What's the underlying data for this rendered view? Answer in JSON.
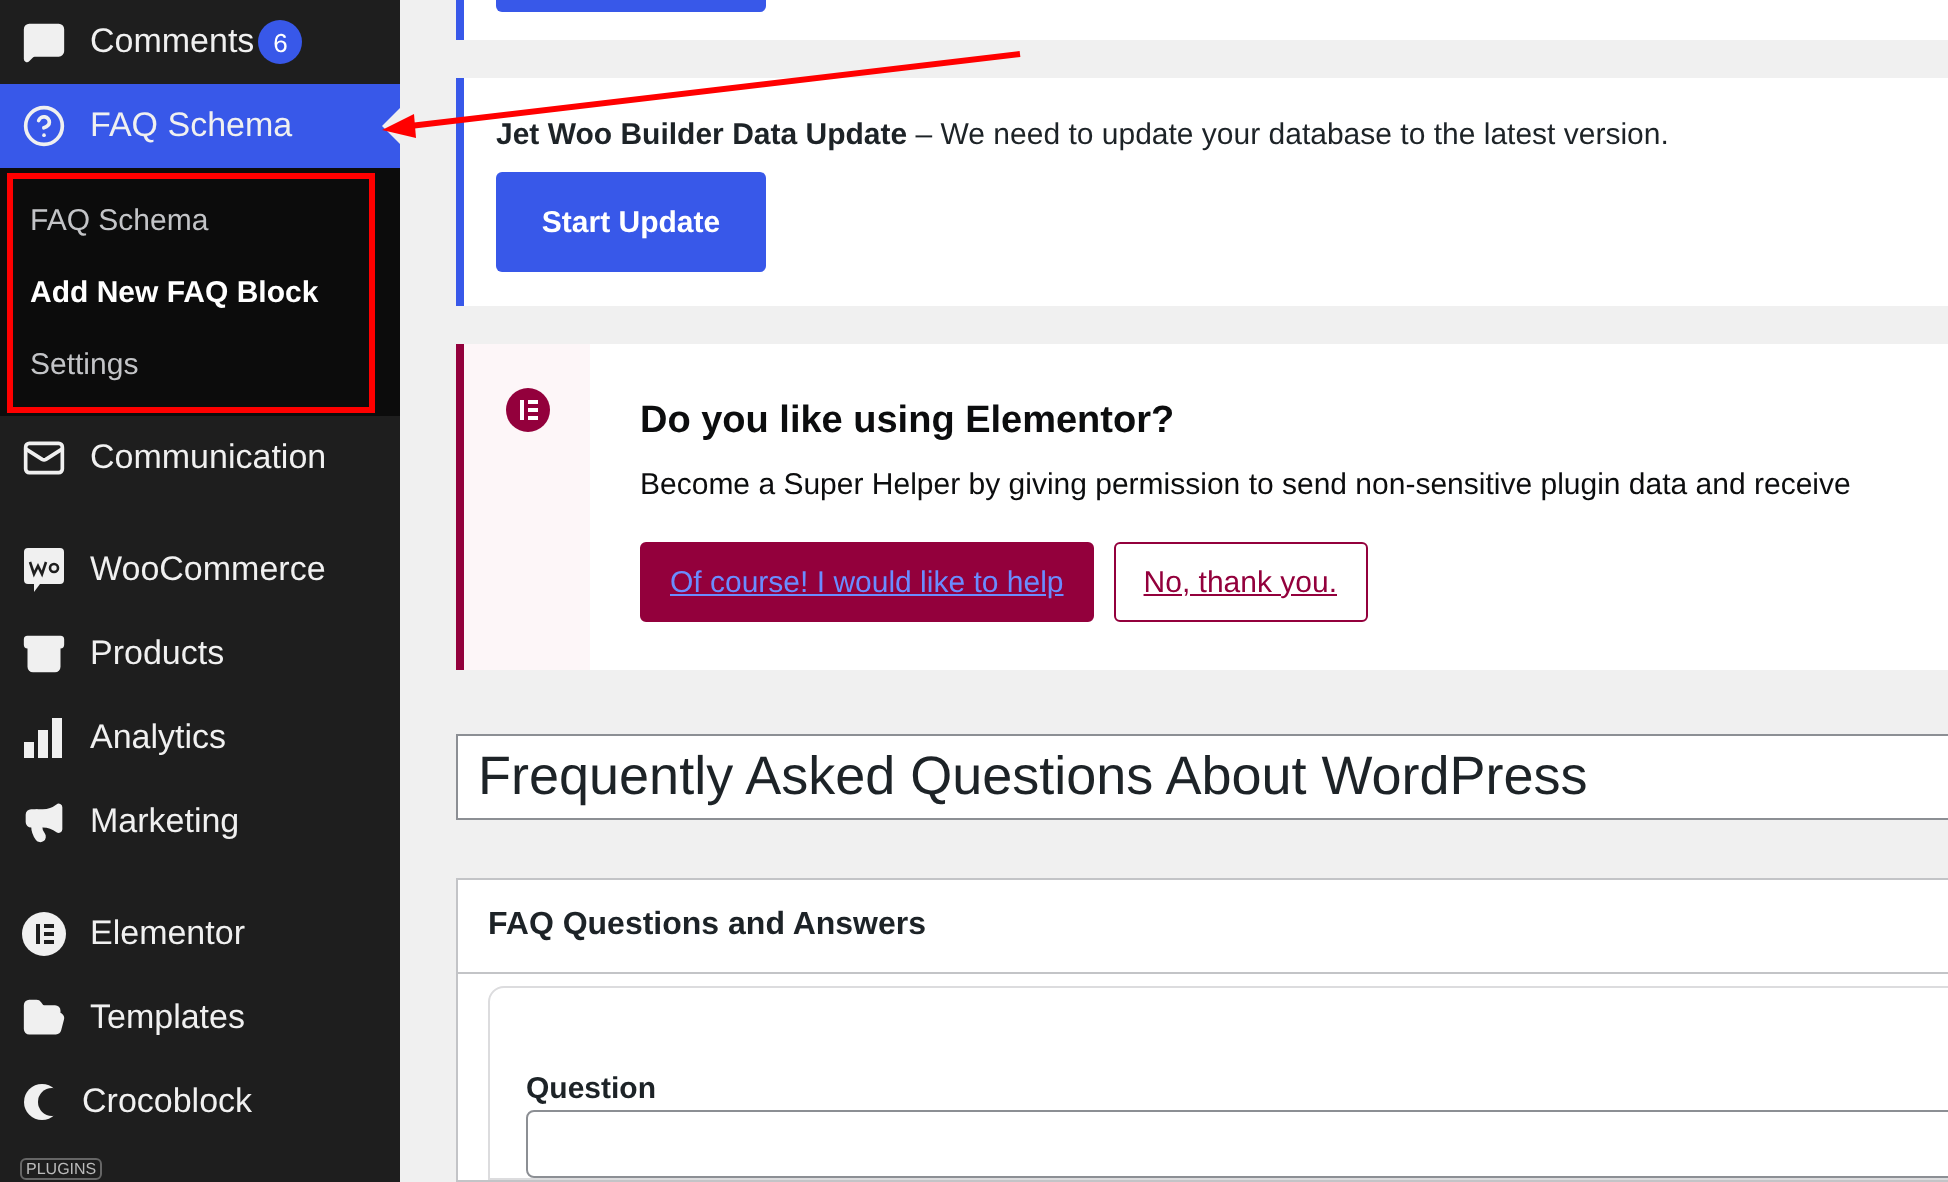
{
  "sidebar": {
    "groups": [
      {
        "items": [
          {
            "label": "Comments",
            "badge": "6",
            "selected": false
          },
          {
            "label": "FAQ Schema",
            "selected": true,
            "expanded": true,
            "submenu": [
              {
                "label": "FAQ Schema",
                "selected": false
              },
              {
                "label": "Add New FAQ Block",
                "selected": true
              },
              {
                "label": "Settings",
                "selected": false
              }
            ]
          },
          {
            "label": "Communication",
            "selected": false
          }
        ]
      },
      {
        "items": [
          {
            "label": "WooCommerce",
            "selected": false
          },
          {
            "label": "Products",
            "selected": false
          },
          {
            "label": "Analytics",
            "selected": false
          },
          {
            "label": "Marketing",
            "selected": false
          }
        ]
      },
      {
        "items": [
          {
            "label": "Elementor",
            "selected": false
          },
          {
            "label": "Templates",
            "selected": false
          },
          {
            "label": "Crocoblock",
            "selected": false
          }
        ]
      }
    ],
    "section_label": "PLUGINS"
  },
  "update_notice": {
    "message": "**Jet Woo Builder Data Update** – We need to update your database to the latest version.",
    "button": "Start Update"
  },
  "elementor_notice": {
    "title": "Do you like using Elementor?",
    "message": "Become a Super Helper by giving permission to send non-sensitive plugin data and receive",
    "buttons": [
      {
        "label": "Of course! I would like to help",
        "kind": "primary"
      },
      {
        "label": "No, thank you.",
        "kind": "secondary"
      }
    ]
  },
  "post_title": {
    "value": "Frequently Asked Questions About WordPress"
  },
  "faq_box": {
    "title": "FAQ Questions and Answers",
    "question_label": "Question"
  }
}
